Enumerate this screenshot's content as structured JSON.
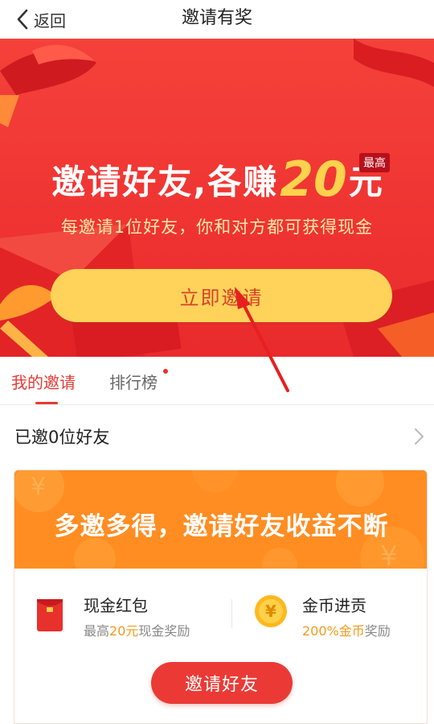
{
  "nav": {
    "back_label": "返回",
    "title": "邀请有奖"
  },
  "banner": {
    "headline_text": "邀请好友,各赚",
    "headline_amount": "20",
    "headline_unit": "元",
    "max_badge": "最高",
    "subline": "每邀请1位好友，你和对方都可获得现金",
    "invite_now_label": "立即邀请"
  },
  "tabs": [
    {
      "label": "我的邀请",
      "active": true
    },
    {
      "label": "排行榜",
      "active": false,
      "has_dot": true
    }
  ],
  "invited": {
    "label": "已邀0位好友"
  },
  "promo": {
    "banner_text": "多邀多得，邀请好友收益不断",
    "cash": {
      "title": "现金红包",
      "sub_prefix": "最高",
      "sub_highlight": "20元",
      "sub_suffix": "现金奖励"
    },
    "coin": {
      "title": "金币进贡",
      "sub_highlight": "200%金币",
      "sub_suffix": "奖励",
      "icon_glyph": "¥"
    },
    "invite_friends_label": "邀请好友"
  },
  "colors": {
    "brand_red": "#eb3a35",
    "banner_red": "#f0302f",
    "gold": "#ffd35a",
    "orange": "#ff8a1e",
    "highlight_orange": "#f29a1e"
  }
}
